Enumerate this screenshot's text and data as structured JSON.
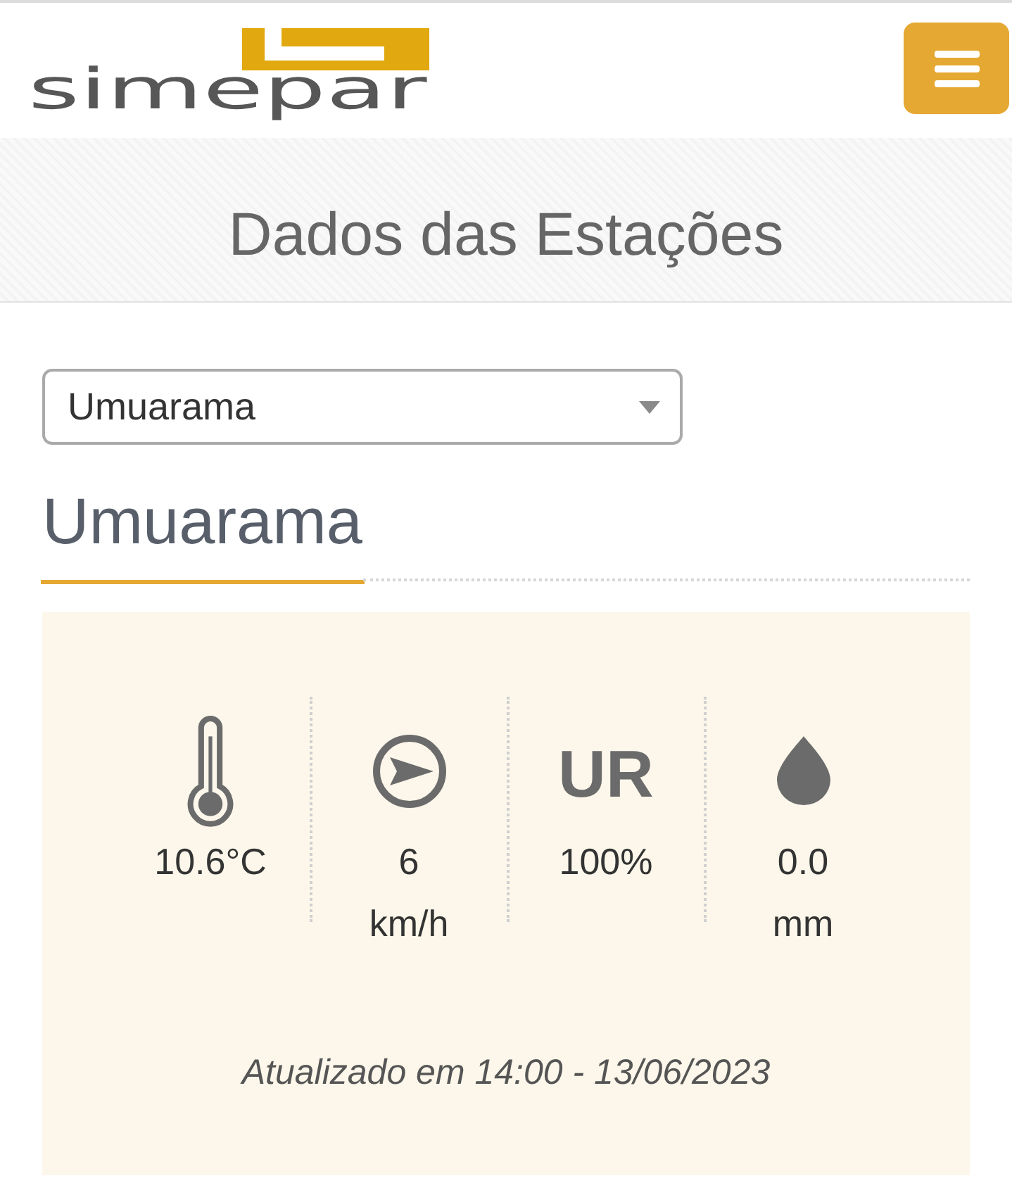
{
  "header": {
    "logo": {
      "wordmark": "simepar"
    }
  },
  "page_title": "Dados das Estações",
  "station_select": {
    "value": "Umuarama"
  },
  "station_heading": "Umuarama",
  "readings": [
    {
      "kind": "temperature",
      "value": "10.6°C"
    },
    {
      "kind": "wind",
      "value": "6",
      "unit": "km/h"
    },
    {
      "kind": "humidity",
      "label": "UR",
      "value": "100%"
    },
    {
      "kind": "rain",
      "value": "0.0",
      "unit": "mm"
    }
  ],
  "updated": "Atualizado em 14:00 - 13/06/2023"
}
